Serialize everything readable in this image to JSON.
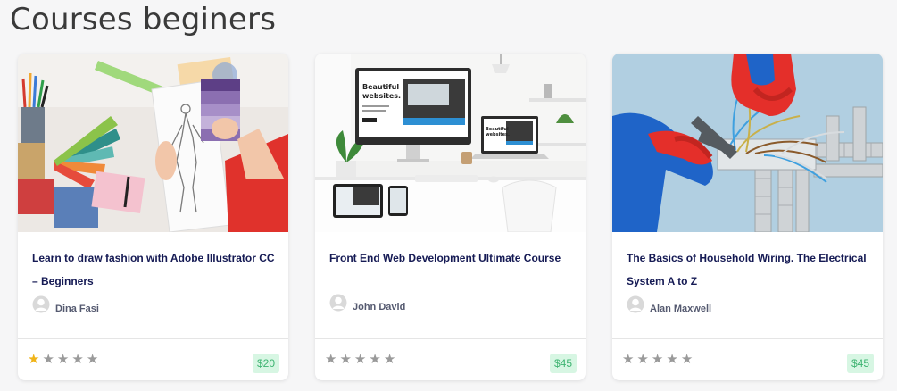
{
  "section": {
    "title": "Courses beginers"
  },
  "colors": {
    "price_bg": "#d7f6e3",
    "price_text": "#3fb472",
    "star_filled": "#f0b419",
    "star_empty": "#9a9a9a",
    "title_text": "#151a54"
  },
  "courses": [
    {
      "image": "fashion-sketch-photo",
      "title": "Learn to draw fashion with Adobe Illustrator CC – Beginners",
      "author": "Dina Fasi",
      "rating": 1,
      "rating_max": 5,
      "price": "$20"
    },
    {
      "image": "desk-computer-photo",
      "title": "Front End Web Development Ultimate Course",
      "author": "John David",
      "rating": 0,
      "rating_max": 5,
      "price": "$45"
    },
    {
      "image": "electrical-wiring-photo",
      "title": "The Basics of Household Wiring. The Electrical System A to Z",
      "author": "Alan Maxwell",
      "rating": 0,
      "rating_max": 5,
      "price": "$45"
    }
  ],
  "screen_text": {
    "monitor_headline": "Beautiful websites.",
    "laptop_headline": "Beautiful websites."
  }
}
